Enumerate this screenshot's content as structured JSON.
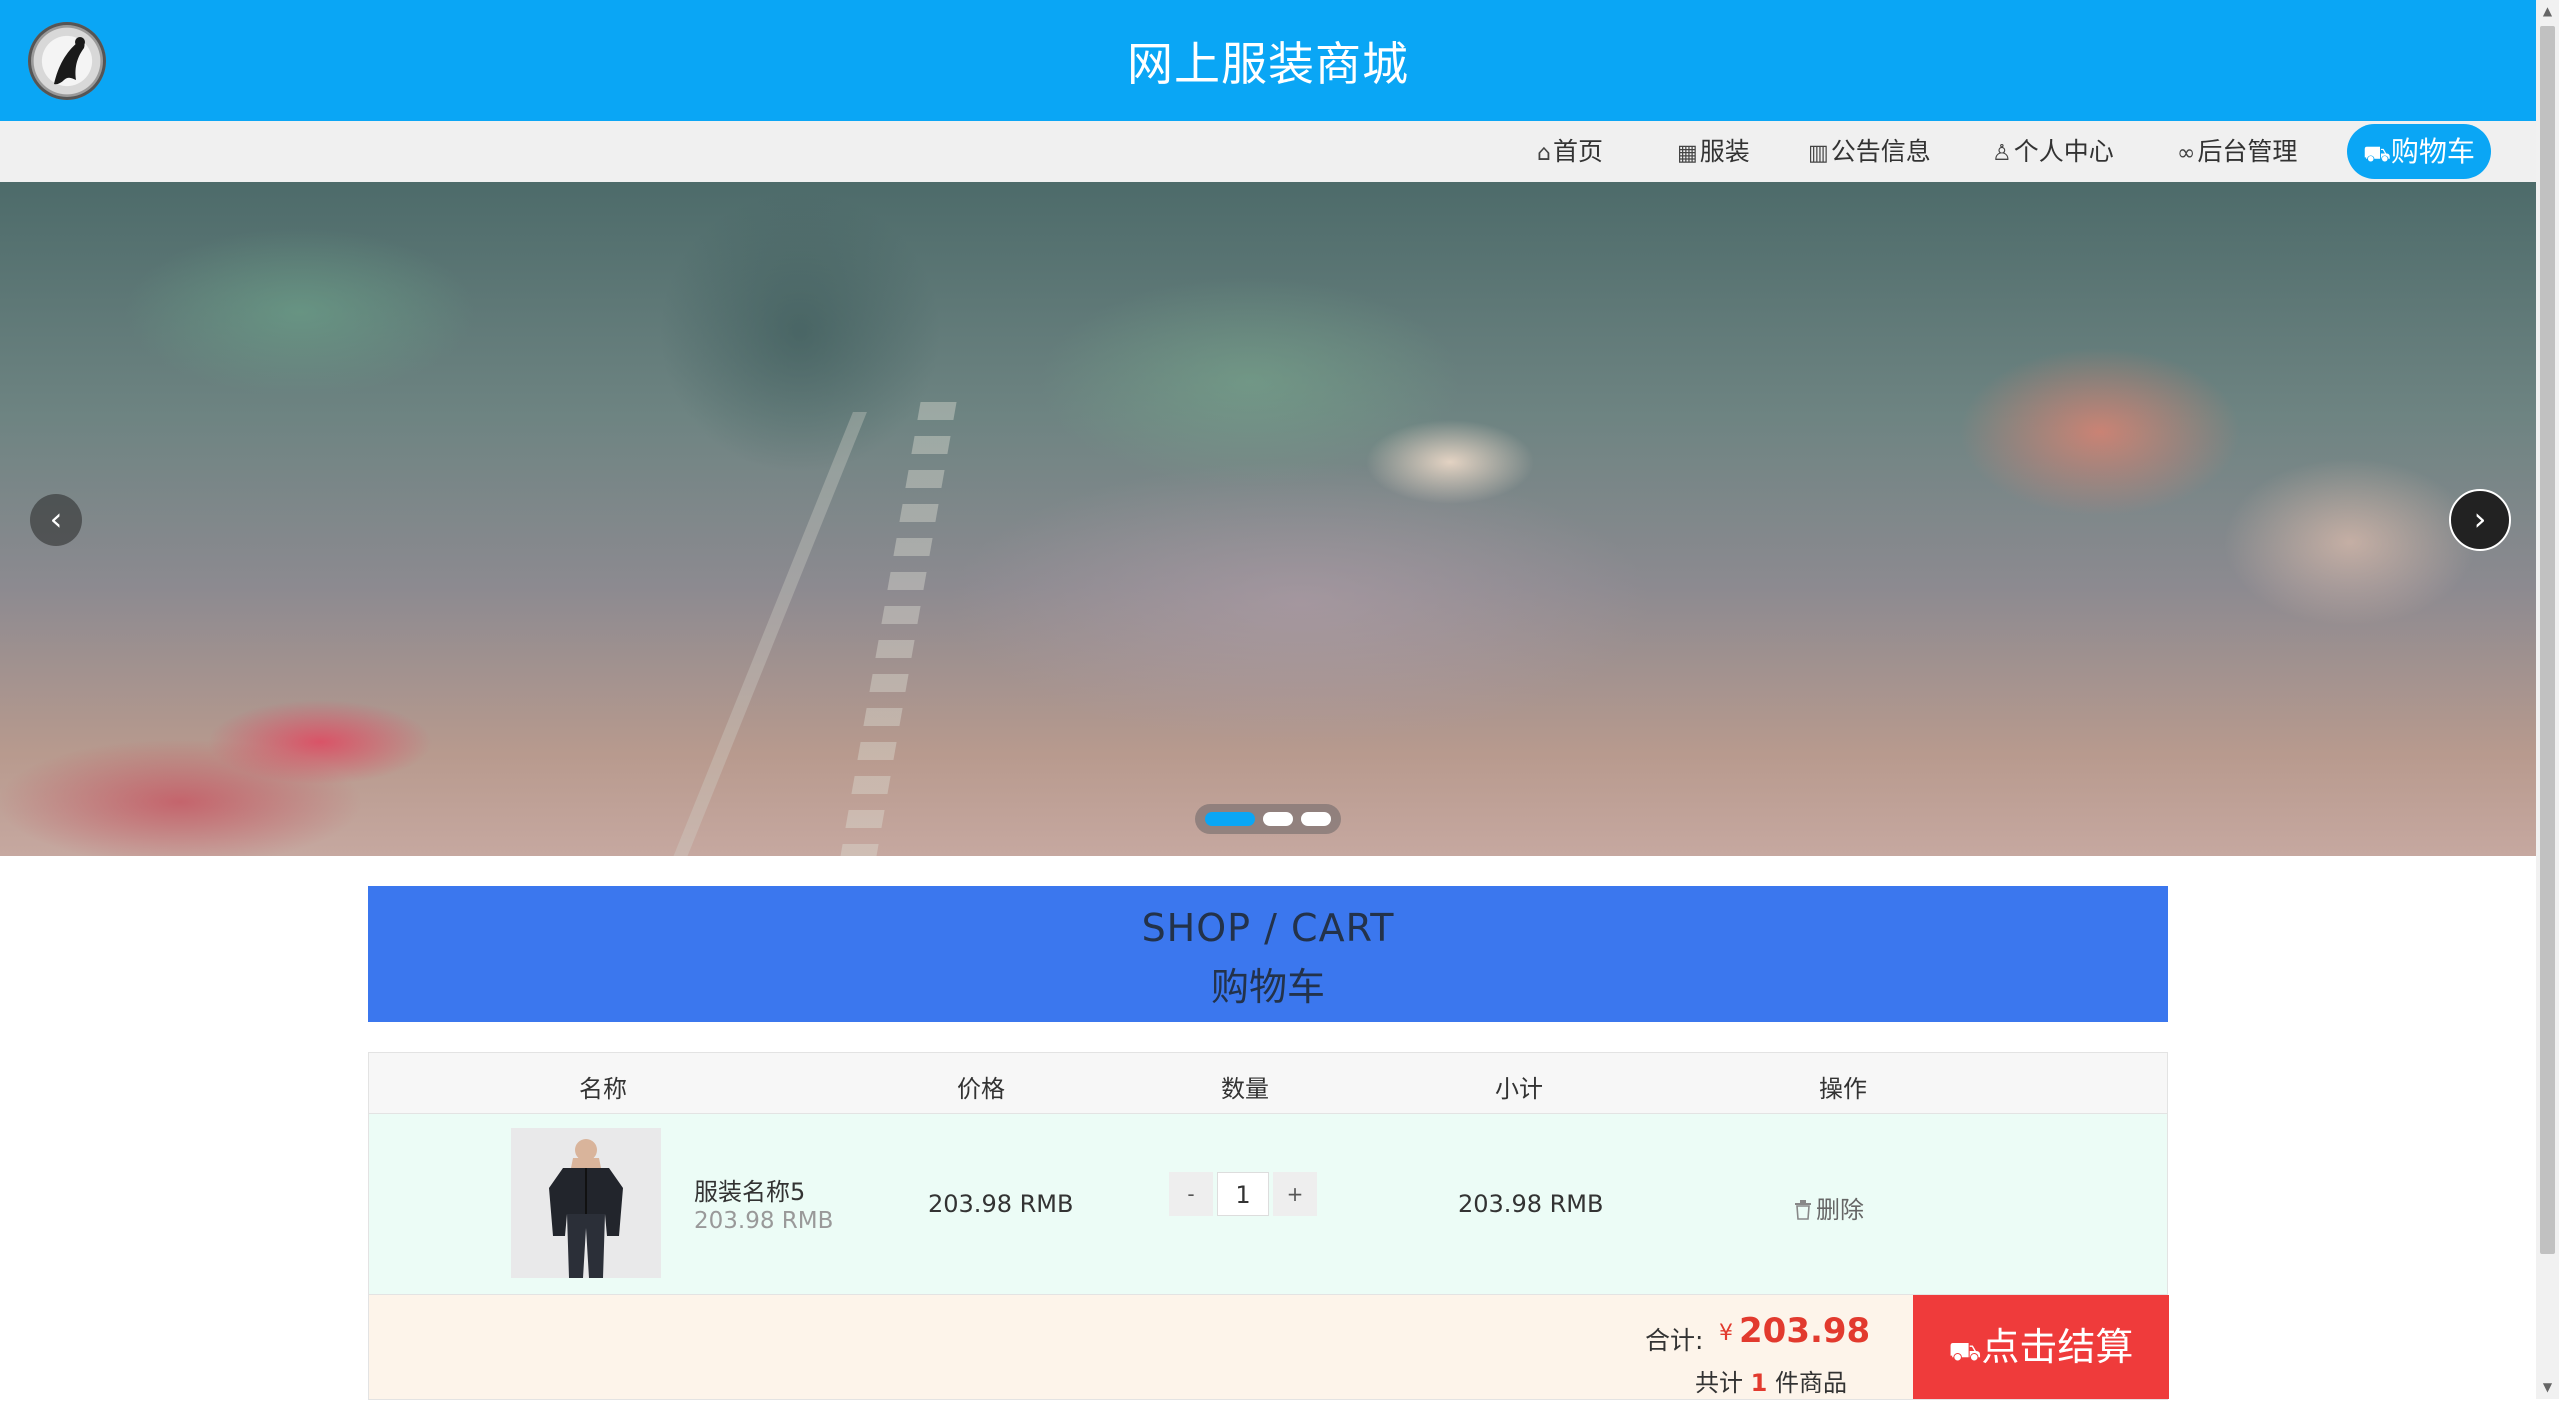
{
  "header": {
    "title": "网上服装商城"
  },
  "nav": {
    "items": [
      {
        "icon": "home-icon",
        "glyph": "⌂",
        "label": "首页"
      },
      {
        "icon": "gift-icon",
        "glyph": "▦",
        "label": "服装"
      },
      {
        "icon": "notice-icon",
        "glyph": "▥",
        "label": "公告信息"
      },
      {
        "icon": "user-icon",
        "glyph": "♙",
        "label": "个人中心"
      },
      {
        "icon": "link-icon",
        "glyph": "∞",
        "label": "后台管理"
      }
    ],
    "cart": {
      "icon": "cart-icon",
      "glyph": "⛟",
      "label": "购物车"
    }
  },
  "banner": {
    "prev_glyph": "‹",
    "next_glyph": "›",
    "slide_count": 3,
    "active_slide": 1
  },
  "cart": {
    "title_en": "SHOP / CART",
    "title_cn": "购物车",
    "columns": [
      "名称",
      "价格",
      "数量",
      "小计",
      "操作"
    ],
    "rows": [
      {
        "name": "服装名称5",
        "sub_price": "203.98 RMB",
        "price": "203.98 RMB",
        "qty_minus": "-",
        "qty": "1",
        "qty_plus": "+",
        "subtotal": "203.98 RMB",
        "action_icon": "trash-icon",
        "action": "删除"
      }
    ],
    "total_label": "合计:",
    "currency": "¥",
    "total": "203.98",
    "count_prefix": "共计",
    "count": "1",
    "count_suffix": "件商品",
    "checkout_label": "点击结算"
  },
  "colors": {
    "header_bg": "#0aa6f5",
    "cart_header_bg": "#3b77ee",
    "checkout_bg": "#ef3b3b",
    "price_red": "#e23a2e"
  }
}
